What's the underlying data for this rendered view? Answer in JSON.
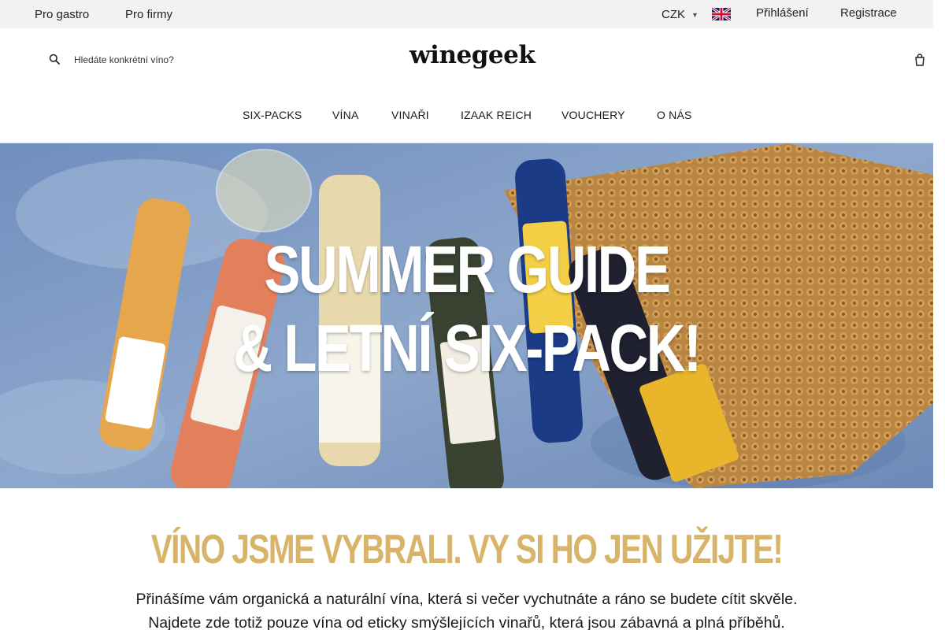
{
  "topbar": {
    "links": [
      "Pro gastro",
      "Pro firmy"
    ],
    "currency": "CZK",
    "language_flag": "uk-flag-icon",
    "login": "Přihlášení",
    "register": "Registrace"
  },
  "header": {
    "search_placeholder": "Hledáte konkrétní víno?",
    "logo": "winegeek",
    "search_icon": "search-icon",
    "cart_icon": "cart-icon"
  },
  "nav": {
    "items": [
      "SIX-PACKS",
      "VÍNA",
      "VINAŘI",
      "IZAAK REICH",
      "VOUCHERY",
      "O NÁS"
    ]
  },
  "hero": {
    "line1": "SUMMER GUIDE",
    "line2": "& LETNÍ SIX-PACK!"
  },
  "intro": {
    "title": "VÍNO JSME VYBRALI. VY SI HO JEN UŽIJTE!",
    "text1": "Přinášíme vám organická a naturální vína, která si večer vychutnáte a ráno se budete cítit skvěle.",
    "text2": "Najdete zde totiž pouze vína od eticky smýšlejících vinařů, která jsou zábavná a plná příběhů."
  },
  "colors": {
    "accent_gold": "#d8b46a",
    "topbar_bg": "#f2f2f2",
    "hero_blue": "#7f98bd"
  }
}
